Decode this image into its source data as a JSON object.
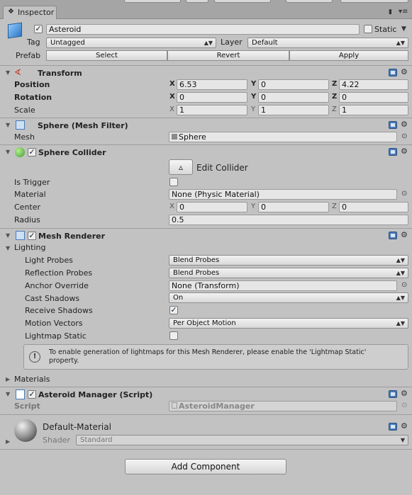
{
  "tab": {
    "label": "Inspector"
  },
  "object": {
    "name": "Asteroid",
    "static_label": "Static",
    "tag_label": "Tag",
    "tag_value": "Untagged",
    "layer_label": "Layer",
    "layer_value": "Default",
    "prefab_label": "Prefab",
    "prefab_select": "Select",
    "prefab_revert": "Revert",
    "prefab_apply": "Apply"
  },
  "transform": {
    "title": "Transform",
    "position_label": "Position",
    "pos": [
      "6.53",
      "0",
      "4.22"
    ],
    "rotation_label": "Rotation",
    "rot": [
      "0",
      "0",
      "0"
    ],
    "scale_label": "Scale",
    "scl": [
      "1",
      "1",
      "1"
    ],
    "axes": [
      "X",
      "Y",
      "Z"
    ]
  },
  "mesh_filter": {
    "title": "Sphere (Mesh Filter)",
    "mesh_label": "Mesh",
    "mesh_value": "Sphere"
  },
  "collider": {
    "title": "Sphere Collider",
    "edit_label": "Edit Collider",
    "is_trigger_label": "Is Trigger",
    "material_label": "Material",
    "material_value": "None (Physic Material)",
    "center_label": "Center",
    "center": [
      "0",
      "0",
      "0"
    ],
    "radius_label": "Radius",
    "radius_value": "0.5"
  },
  "renderer": {
    "title": "Mesh Renderer",
    "lighting_label": "Lighting",
    "light_probes_label": "Light Probes",
    "light_probes_value": "Blend Probes",
    "reflection_probes_label": "Reflection Probes",
    "reflection_probes_value": "Blend Probes",
    "anchor_override_label": "Anchor Override",
    "anchor_override_value": "None (Transform)",
    "cast_shadows_label": "Cast Shadows",
    "cast_shadows_value": "On",
    "receive_shadows_label": "Receive Shadows",
    "motion_vectors_label": "Motion Vectors",
    "motion_vectors_value": "Per Object Motion",
    "lightmap_static_label": "Lightmap Static",
    "info_line1": "To enable generation of lightmaps for this Mesh Renderer, please enable the 'Lightmap Static'",
    "info_line2": "property.",
    "materials_label": "Materials"
  },
  "script": {
    "title": "Asteroid Manager (Script)",
    "script_label": "Script",
    "script_value": "AsteroidManager"
  },
  "material": {
    "name": "Default-Material",
    "shader_label": "Shader",
    "shader_value": "Standard"
  },
  "add_component": "Add Component",
  "colors": {
    "accent_blue": "#4a7ab8",
    "panel_bg": "#c2c2c2",
    "check_green": "#3f9b32"
  }
}
